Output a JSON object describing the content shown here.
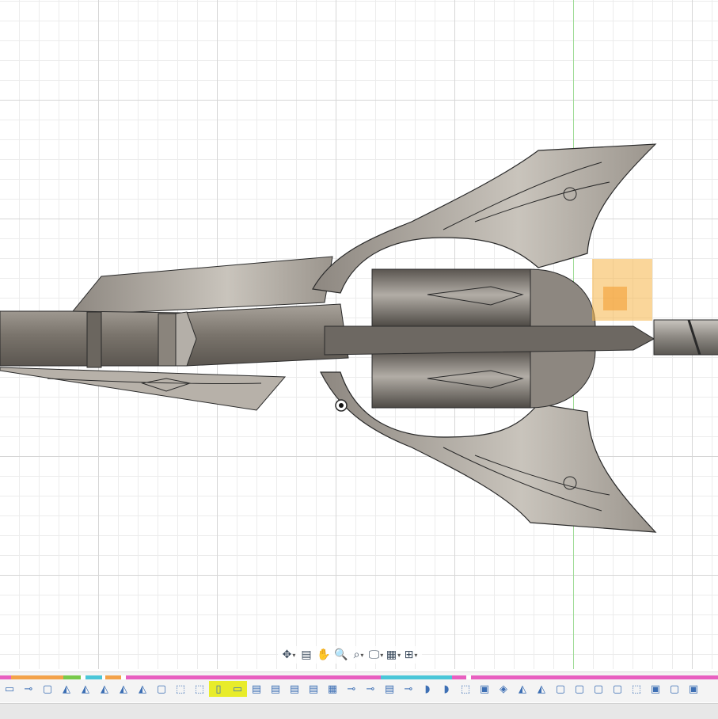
{
  "canvas": {
    "background": "#ffffff",
    "grid_major": "#d6d6d6",
    "grid_minor": "#ececec",
    "origin_axis_color": "#9fdc97",
    "selection_color": "#f5b547",
    "model_name": "ornate-blade-weapon"
  },
  "nav_toolbar": {
    "items": [
      {
        "name": "orbit-icon",
        "glyph": "✥"
      },
      {
        "name": "look-at-icon",
        "glyph": "▤"
      },
      {
        "name": "pan-icon",
        "glyph": "✋"
      },
      {
        "name": "zoom-icon",
        "glyph": "🔍"
      },
      {
        "name": "fit-icon",
        "glyph": "⌕"
      },
      {
        "name": "display-settings-icon",
        "glyph": "🖵"
      },
      {
        "name": "grid-settings-icon",
        "glyph": "▦"
      },
      {
        "name": "viewports-icon",
        "glyph": "⊞"
      }
    ]
  },
  "ribbon": {
    "colorbar": [
      {
        "color": "#e85fc0",
        "w": 14
      },
      {
        "color": "#f3a24a",
        "w": 68
      },
      {
        "color": "#78c94a",
        "w": 22
      },
      {
        "color": "#ffffff",
        "w": 6
      },
      {
        "color": "#4bc6d8",
        "w": 22
      },
      {
        "color": "#ffffff",
        "w": 4
      },
      {
        "color": "#f3a24a",
        "w": 20
      },
      {
        "color": "#ffffff",
        "w": 6
      },
      {
        "color": "#e85fc0",
        "w": 330
      },
      {
        "color": "#4bc6d8",
        "w": 92
      },
      {
        "color": "#e85fc0",
        "w": 18
      },
      {
        "color": "#ffffff",
        "w": 6
      },
      {
        "color": "#e85fc0",
        "w": 319
      }
    ]
  }
}
